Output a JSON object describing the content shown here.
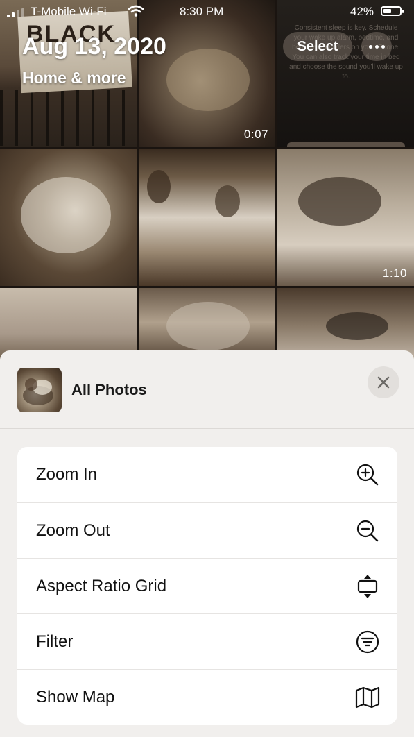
{
  "status_bar": {
    "carrier": "T-Mobile Wi-Fi",
    "time": "8:30 PM",
    "battery": "42%"
  },
  "header": {
    "date": "Aug 13, 2020",
    "subtitle": "Home & more",
    "select_label": "Select"
  },
  "grid": {
    "sign_text": "BLACK",
    "screenshot_text": "Consistent sleep is key. Schedule your wake up alarm, bedtime, and bedtime reminders on your iPhone. You can also track your time in bed and choose the sound you'll wake up to.",
    "durations": [
      "0:07",
      "1:10"
    ]
  },
  "sheet": {
    "title": "All Photos",
    "items": [
      {
        "label": "Zoom In",
        "icon": "zoom-in-icon"
      },
      {
        "label": "Zoom Out",
        "icon": "zoom-out-icon"
      },
      {
        "label": "Aspect Ratio Grid",
        "icon": "aspect-ratio-icon"
      },
      {
        "label": "Filter",
        "icon": "filter-icon"
      },
      {
        "label": "Show Map",
        "icon": "map-icon"
      }
    ]
  }
}
